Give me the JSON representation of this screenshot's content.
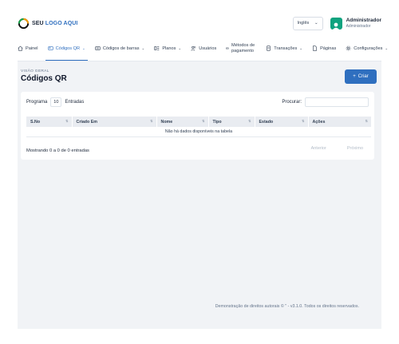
{
  "brand": {
    "logo_prefix": "SEU",
    "logo_text": "LOGO AQUI"
  },
  "language": {
    "selected": "Inglês"
  },
  "user": {
    "name": "Administrador",
    "role": "Administrador"
  },
  "nav": [
    {
      "label": "Painel",
      "icon": "home-icon",
      "dropdown": false,
      "active": false
    },
    {
      "label": "Códigos QR",
      "icon": "qr-icon",
      "dropdown": true,
      "active": true
    },
    {
      "label": "Códigos de barras",
      "icon": "barcode-icon",
      "dropdown": true,
      "active": false
    },
    {
      "label": "Planos",
      "icon": "plans-icon",
      "dropdown": true,
      "active": false
    },
    {
      "label": "Usuários",
      "icon": "users-icon",
      "dropdown": false,
      "active": false
    },
    {
      "label": "Métodos de pagamento",
      "icon": "payment-icon",
      "dropdown": false,
      "active": false
    },
    {
      "label": "Transações",
      "icon": "transactions-icon",
      "dropdown": true,
      "active": false
    },
    {
      "label": "Páginas",
      "icon": "pages-icon",
      "dropdown": false,
      "active": false
    },
    {
      "label": "Configurações",
      "icon": "settings-icon",
      "dropdown": true,
      "active": false
    }
  ],
  "page": {
    "breadcrumb": "VISÃO GERAL",
    "title": "Códigos QR",
    "create_label": "Criar"
  },
  "table": {
    "length_label_before": "Programa",
    "length_value": "10",
    "length_label_after": "Entradas",
    "search_label": "Procurar:",
    "columns": [
      "S.No",
      "Criado Em",
      "Nome",
      "Tipo",
      "Estado",
      "Ações"
    ],
    "empty_message": "Não há dados disponíveis na tabela",
    "info": "Mostrando 0 a 0 de 0 entradas",
    "prev_label": "Anterior",
    "next_label": "Próximo"
  },
  "footer": {
    "text": "Demonstração de direitos autorais © \" - v3.1.0. Todos os direitos reservados."
  },
  "colors": {
    "accent": "#2f6fbf",
    "avatar": "#10a37f",
    "background": "#f1f3f6"
  }
}
